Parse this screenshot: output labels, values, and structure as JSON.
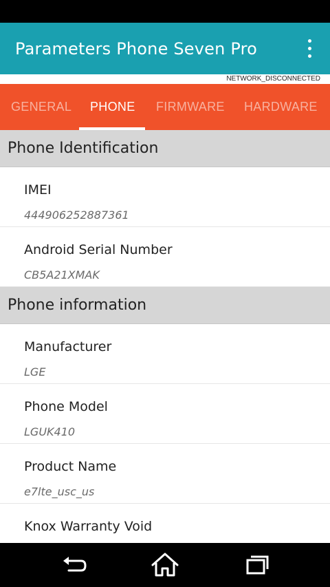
{
  "app_bar": {
    "title": "Parameters Phone Seven Pro",
    "overflow_icon": "more-vert-icon",
    "color": "#1aa0b0"
  },
  "network_status": "NETWORK_DISCONNECTED",
  "tabs": {
    "color": "#f0522a",
    "items": [
      {
        "label": "GENERAL",
        "active": false
      },
      {
        "label": "PHONE",
        "active": true
      },
      {
        "label": "FIRMWARE",
        "active": false
      },
      {
        "label": "HARDWARE",
        "active": false
      }
    ]
  },
  "sections": [
    {
      "title": "Phone Identification",
      "items": [
        {
          "label": "IMEI",
          "value": "444906252887361"
        },
        {
          "label": "Android Serial Number",
          "value": "CB5A21XMAK"
        }
      ]
    },
    {
      "title": "Phone information",
      "items": [
        {
          "label": "Manufacturer",
          "value": "LGE"
        },
        {
          "label": "Phone Model",
          "value": "LGUK410"
        },
        {
          "label": "Product Name",
          "value": "e7lte_usc_us"
        },
        {
          "label": "Knox Warranty Void",
          "value": ""
        }
      ]
    }
  ],
  "nav_bar": {
    "back_icon": "back-icon",
    "home_icon": "home-icon",
    "recents_icon": "recents-icon"
  }
}
